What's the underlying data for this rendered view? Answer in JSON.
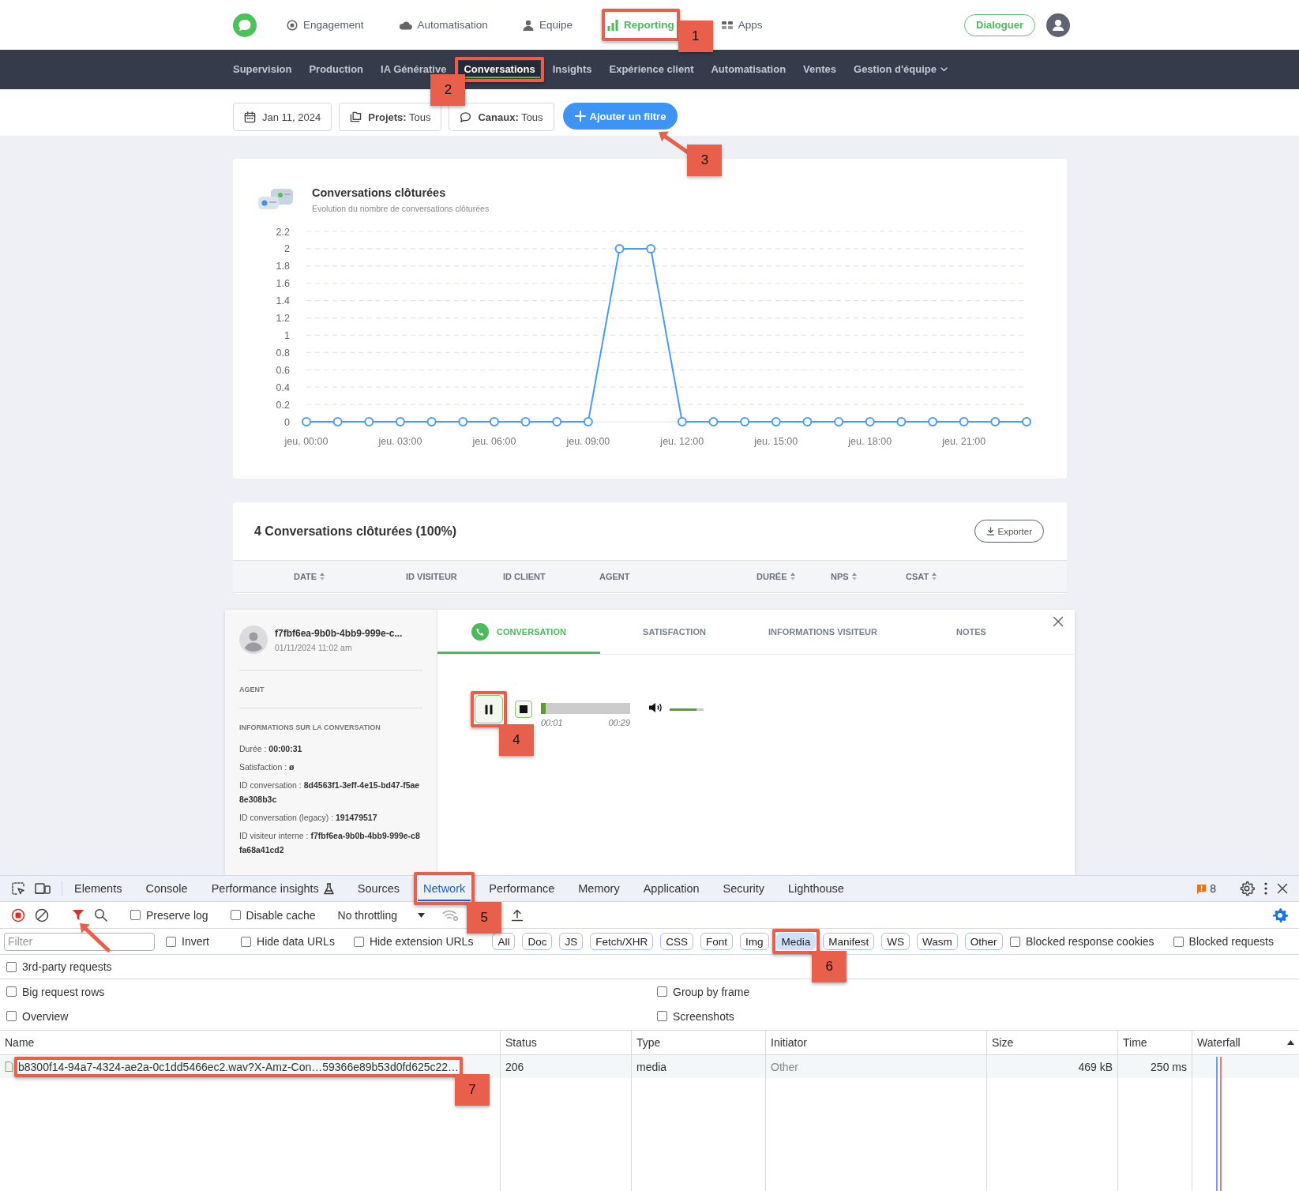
{
  "top_nav": {
    "items": [
      {
        "label": "Engagement",
        "selected": false
      },
      {
        "label": "Automatisation",
        "selected": false
      },
      {
        "label": "Equipe",
        "selected": false
      },
      {
        "label": "Reporting",
        "selected": true,
        "callout": {
          "kind": "frame",
          "label": "1",
          "badge_left": false,
          "badge_below": false
        }
      },
      {
        "label": "Apps",
        "selected": false
      }
    ],
    "action_button": "Dialoguer"
  },
  "sub_nav": {
    "items": [
      {
        "label": "Supervision",
        "selected": false,
        "dropdown": false
      },
      {
        "label": "Production",
        "selected": false,
        "dropdown": false
      },
      {
        "label": "IA Générative",
        "selected": false,
        "dropdown": false
      },
      {
        "label": "Conversations",
        "selected": true,
        "dropdown": false,
        "callout": {
          "kind": "frame",
          "label": "2",
          "badge_left": true,
          "badge_below": false
        }
      },
      {
        "label": "Insights",
        "selected": false,
        "dropdown": false
      },
      {
        "label": "Expérience client",
        "selected": false,
        "dropdown": false
      },
      {
        "label": "Automatisation",
        "selected": false,
        "dropdown": false
      },
      {
        "label": "Ventes",
        "selected": false,
        "dropdown": false
      },
      {
        "label": "Gestion d'équipe",
        "selected": false,
        "dropdown": true
      }
    ]
  },
  "filters": {
    "chips": [
      {
        "text": "Jan 11, 2024"
      },
      {
        "text": "**Projets:** Tous"
      },
      {
        "text": "**Canaux:** Tous"
      }
    ],
    "add_button": {
      "label": "Ajouter un filtre",
      "callout": {
        "kind": "arrow",
        "label": "3"
      }
    }
  },
  "chart_card": {
    "subtitle": "Evolution du nombre de conversations clôturées",
    "chart_data": {
      "type": "line",
      "title": "Conversations clôturées",
      "categories": [
        "jeu. 00:00",
        null,
        null,
        "jeu. 03:00",
        null,
        null,
        "jeu. 06:00",
        null,
        null,
        "jeu. 09:00",
        null,
        null,
        "jeu. 12:00",
        null,
        null,
        "jeu. 15:00",
        null,
        null,
        "jeu. 18:00",
        null,
        null,
        "jeu. 21:00",
        null,
        null
      ],
      "grid": true,
      "series": [
        {
          "color": "#4a9af5",
          "marker": "circle",
          "values": [
            0,
            0,
            0,
            0,
            0,
            0,
            0,
            0,
            0,
            0,
            2,
            2,
            0,
            0,
            0,
            0,
            0,
            0,
            0,
            0,
            0,
            0,
            0,
            0
          ]
        }
      ],
      "ylim": [
        0,
        2.2
      ],
      "yticks": [
        0,
        0.2,
        0.4,
        0.6,
        0.8,
        1,
        1.2,
        1.4,
        1.6,
        1.8,
        2,
        2.2
      ]
    }
  },
  "table": {
    "title": "4 Conversations clôturées (100%)",
    "export_button": "Exporter",
    "columns": [
      {
        "label": "DATE",
        "sortable": true
      },
      {
        "label": "ID VISITEUR",
        "sortable": false
      },
      {
        "label": "ID CLIENT",
        "sortable": false
      },
      {
        "label": "AGENT",
        "sortable": false
      },
      {
        "label": "DURÉE",
        "sortable": true
      },
      {
        "label": "NPS",
        "sortable": true
      },
      {
        "label": "CSAT",
        "sortable": true
      }
    ]
  },
  "detail": {
    "visitor": "f7fbf6ea-9b0b-4bb9-999e-c...",
    "date": "01/11/2024 11:02 am",
    "agent_heading": "AGENT",
    "info_heading": "INFORMATIONS SUR LA CONVERSATION",
    "info_lines": [
      "Durée : **00:00:31**",
      "Satisfaction : **ø**",
      "ID conversation : **8d4563f1-3eff-4e15-bd47-f5ae8e308b3c**",
      "ID conversation (legacy) : **191479517**",
      "ID visiteur interne : **f7fbf6ea-9b0b-4bb9-999e-c8fa68a41cd2**"
    ],
    "tabs": [
      {
        "label": "CONVERSATION",
        "selected": true
      },
      {
        "label": "SATISFACTION",
        "selected": false
      },
      {
        "label": "INFORMATIONS VISITEUR",
        "selected": false
      },
      {
        "label": "NOTES",
        "selected": false
      }
    ],
    "player": {
      "playing": true,
      "callout": {
        "kind": "frame",
        "label": "4",
        "badge_left": false,
        "badge_below": true
      },
      "progress": {
        "level": 0.05
      },
      "elapsed": "00:01",
      "total": "00:29",
      "volume": {
        "level": 0.78
      }
    }
  },
  "devtools": {
    "tabs": [
      {
        "label": "Elements",
        "selected": false
      },
      {
        "label": "Console",
        "selected": false
      },
      {
        "label": "Performance insights",
        "selected": false
      },
      {
        "label": "Sources",
        "selected": false
      },
      {
        "label": "Network",
        "selected": true,
        "callout": {
          "kind": "frame",
          "label": "5",
          "badge_left": false,
          "badge_below": true
        }
      },
      {
        "label": "Performance",
        "selected": false
      },
      {
        "label": "Memory",
        "selected": false
      },
      {
        "label": "Application",
        "selected": false
      },
      {
        "label": "Security",
        "selected": false
      },
      {
        "label": "Lighthouse",
        "selected": false
      }
    ],
    "issues_count": "8",
    "toolbar": {
      "filter_active": true,
      "filter_callout": {
        "kind": "arrow"
      },
      "checkboxes": [
        {
          "label": "Preserve log",
          "checked": false
        },
        {
          "label": "Disable cache",
          "checked": false
        }
      ],
      "throttling": "No throttling"
    },
    "filter_row": {
      "placeholder": "Filter",
      "checkboxes_before": [
        {
          "label": "Invert",
          "checked": false
        },
        {
          "label": "Hide data URLs",
          "checked": false
        },
        {
          "label": "Hide extension URLs",
          "checked": false
        }
      ],
      "types": [
        {
          "label": "All",
          "selected": false
        },
        {
          "label": "Doc",
          "selected": false
        },
        {
          "label": "JS",
          "selected": false
        },
        {
          "label": "Fetch/XHR",
          "selected": false
        },
        {
          "label": "CSS",
          "selected": false
        },
        {
          "label": "Font",
          "selected": false
        },
        {
          "label": "Img",
          "selected": false
        },
        {
          "label": "Media",
          "selected": true,
          "callout": {
            "kind": "frame",
            "label": "6",
            "badge_left": false,
            "badge_below": true
          }
        },
        {
          "label": "Manifest",
          "selected": false
        },
        {
          "label": "WS",
          "selected": false
        },
        {
          "label": "Wasm",
          "selected": false
        },
        {
          "label": "Other",
          "selected": false
        }
      ],
      "checkboxes_after": [
        {
          "label": "Blocked response cookies",
          "checked": false
        },
        {
          "label": "Blocked requests",
          "checked": false
        }
      ]
    },
    "option_rows": [
      [
        {
          "label": "3rd-party requests",
          "checked": false
        }
      ],
      [
        {
          "label": "Big request rows",
          "checked": false
        },
        {
          "label": "Group by frame",
          "checked": false
        }
      ],
      [
        {
          "label": "Overview",
          "checked": false
        },
        {
          "label": "Screenshots",
          "checked": false
        }
      ]
    ],
    "requests": {
      "columns": [
        {
          "label": "Name",
          "sorted": false
        },
        {
          "label": "Status",
          "sorted": false
        },
        {
          "label": "Type",
          "sorted": false
        },
        {
          "label": "Initiator",
          "sorted": false
        },
        {
          "label": "Size",
          "sorted": false
        },
        {
          "label": "Time",
          "sorted": false
        },
        {
          "label": "Waterfall",
          "sorted": true
        }
      ],
      "rows": [
        {
          "name": "b8300f14-94a7-4324-ae2a-0c1dd5466ec2.wav?X-Amz-Con…59366e89b53d0fd625c22…",
          "status": "206",
          "type": "media",
          "initiator": "Other",
          "size": "469 kB",
          "time": "250 ms",
          "callout": {
            "kind": "frame",
            "label": "7",
            "badge_left": false,
            "badge_below": true
          }
        }
      ]
    }
  }
}
